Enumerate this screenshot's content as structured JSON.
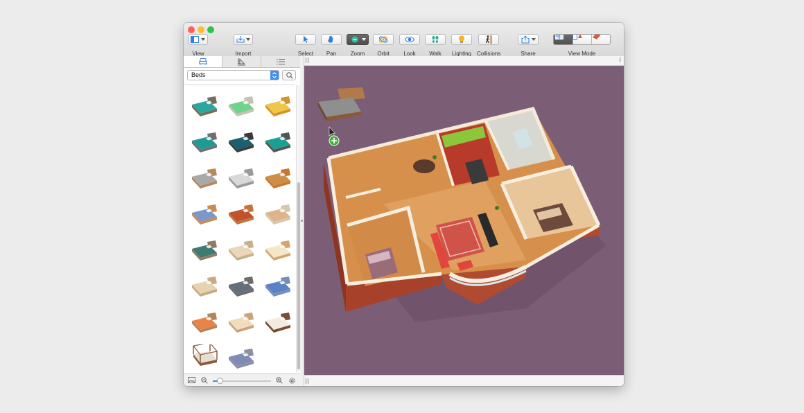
{
  "window": {
    "traffic_lights": {
      "close_color": "#fe5f57",
      "minimize_color": "#febc2e",
      "zoom_color": "#28c840"
    }
  },
  "toolbar": {
    "view": {
      "label": "View",
      "icon": "view-layout-icon"
    },
    "import": {
      "label": "Import",
      "icon": "import-tray-icon"
    },
    "select": {
      "label": "Select",
      "icon": "arrow-cursor-icon"
    },
    "pan": {
      "label": "Pan",
      "icon": "hand-icon"
    },
    "zoom": {
      "label": "Zoom",
      "icon": "zoom-minus-icon"
    },
    "orbit": {
      "label": "Orbit",
      "icon": "orbit-icon"
    },
    "look": {
      "label": "Look",
      "icon": "eye-icon"
    },
    "walk": {
      "label": "Walk",
      "icon": "footsteps-icon"
    },
    "lighting": {
      "label": "Lighting",
      "icon": "lightbulb-icon"
    },
    "collisions": {
      "label": "Collisions",
      "icon": "walking-person-icon"
    },
    "share": {
      "label": "Share",
      "icon": "share-icon"
    },
    "view_mode": {
      "label": "View Mode",
      "options": [
        "2D plan",
        "split",
        "3D"
      ],
      "selected_index": 0
    }
  },
  "sidebar": {
    "tabs": [
      {
        "name": "furniture",
        "icon": "armchair-icon",
        "active": true
      },
      {
        "name": "building",
        "icon": "ruler-square-icon",
        "active": false
      },
      {
        "name": "list",
        "icon": "list-icon",
        "active": false
      }
    ],
    "category": {
      "selected": "Beds"
    },
    "catalog": {
      "items": [
        {
          "icon": "bed-icon",
          "frame": "#7a6a58",
          "cover": "#2aa8a0"
        },
        {
          "icon": "bed-icon",
          "frame": "#c9c0b1",
          "cover": "#6fd38f"
        },
        {
          "icon": "bed-icon",
          "frame": "#d2952d",
          "cover": "#f0c648"
        },
        {
          "icon": "bed-icon",
          "frame": "#6f6f6f",
          "cover": "#1f9b93"
        },
        {
          "icon": "bed-icon",
          "frame": "#3a3a3a",
          "cover": "#1c5f6e"
        },
        {
          "icon": "bed-icon",
          "frame": "#545454",
          "cover": "#199f93"
        },
        {
          "icon": "bed-icon",
          "frame": "#b48a5c",
          "cover": "#a9a9a9"
        },
        {
          "icon": "bed-icon",
          "frame": "#9a9a9a",
          "cover": "#d8d8d8"
        },
        {
          "icon": "bed-icon",
          "frame": "#c9772f",
          "cover": "#cf8e48"
        },
        {
          "icon": "bed-icon",
          "frame": "#c98b52",
          "cover": "#7d97c9"
        },
        {
          "icon": "bed-icon",
          "frame": "#c3743a",
          "cover": "#c0522e"
        },
        {
          "icon": "bed-icon",
          "frame": "#d6c6ad",
          "cover": "#e0b48a"
        },
        {
          "icon": "bed-icon",
          "frame": "#8f7b62",
          "cover": "#3c7c72"
        },
        {
          "icon": "bed-icon",
          "frame": "#c9b08c",
          "cover": "#e8d7b8"
        },
        {
          "icon": "bed-icon",
          "frame": "#d6a46a",
          "cover": "#f4e6c8"
        },
        {
          "icon": "bed-icon",
          "frame": "#c8a983",
          "cover": "#e7d2b2"
        },
        {
          "icon": "bed-icon",
          "frame": "#6c6c6c",
          "cover": "#646f7a"
        },
        {
          "icon": "bed-icon",
          "frame": "#7a8fb6",
          "cover": "#5b82c6"
        },
        {
          "icon": "bed-icon",
          "frame": "#b3835a",
          "cover": "#e8844a"
        },
        {
          "icon": "bed-icon",
          "frame": "#c9a47a",
          "cover": "#f0ddc0"
        },
        {
          "icon": "bed-icon",
          "frame": "#7a4a35",
          "cover": "#f2ece0"
        },
        {
          "icon": "canopy-bed-icon",
          "frame": "#8a5a3c",
          "cover": "#e6ded0"
        },
        {
          "icon": "bed-icon",
          "frame": "#8a8fa3",
          "cover": "#7f8bb5"
        }
      ]
    },
    "bottom": {
      "thumbnail_icon": "image-icon",
      "zoom_out_icon": "zoom-out-icon",
      "zoom_in_icon": "zoom-in-icon",
      "settings_icon": "gear-icon",
      "zoom_level": 0.12
    }
  },
  "viewport": {
    "info_label": "i",
    "background": "#7b5d76",
    "drag_badge_icon": "plus-icon"
  }
}
